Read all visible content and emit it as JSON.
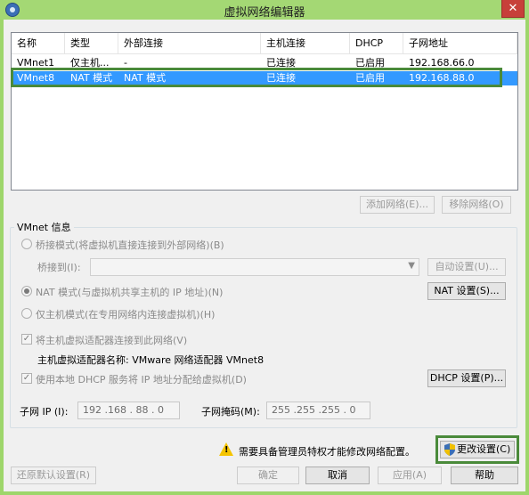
{
  "window": {
    "title": "虚拟网络编辑器",
    "close_glyph": "✕"
  },
  "list": {
    "headers": [
      "名称",
      "类型",
      "外部连接",
      "主机连接",
      "DHCP",
      "子网地址"
    ],
    "rows": [
      [
        "VMnet1",
        "仅主机...",
        "-",
        "已连接",
        "已启用",
        "192.168.66.0"
      ],
      [
        "VMnet8",
        "NAT 模式",
        "NAT 模式",
        "已连接",
        "已启用",
        "192.168.88.0"
      ]
    ],
    "selected_index": 1
  },
  "buttons": {
    "add_network": "添加网络(E)...",
    "remove_network": "移除网络(O)",
    "auto_settings": "自动设置(U)...",
    "nat_settings": "NAT 设置(S)...",
    "dhcp_settings": "DHCP 设置(P)...",
    "change_settings": "更改设置(C)",
    "restore_defaults": "还原默认设置(R)",
    "ok": "确定",
    "cancel": "取消",
    "apply": "应用(A)",
    "help": "帮助"
  },
  "vmnet_info": {
    "group_label": "VMnet 信息",
    "bridge_mode": "桥接模式(将虚拟机直接连接到外部网络)(B)",
    "bridge_to": "桥接到(I):",
    "nat_mode": "NAT 模式(与虚拟机共享主机的 IP 地址)(N)",
    "host_only_mode": "仅主机模式(在专用网络内连接虚拟机)(H)",
    "connect_adapter": "将主机虚拟适配器连接到此网络(V)",
    "adapter_name": "主机虚拟适配器名称: VMware 网络适配器 VMnet8",
    "use_dhcp": "使用本地 DHCP 服务将 IP 地址分配给虚拟机(D)",
    "subnet_ip_label": "子网 IP (I):",
    "subnet_ip": "192 .168 . 88 . 0",
    "subnet_mask_label": "子网掩码(M):",
    "subnet_mask": "255 .255 .255 . 0"
  },
  "warning": {
    "text": "需要具备管理员特权才能修改网络配置。"
  },
  "colors": {
    "titlebar": "#a4d874",
    "selection": "#3399ff",
    "highlight_outline": "#4a8a3a"
  }
}
